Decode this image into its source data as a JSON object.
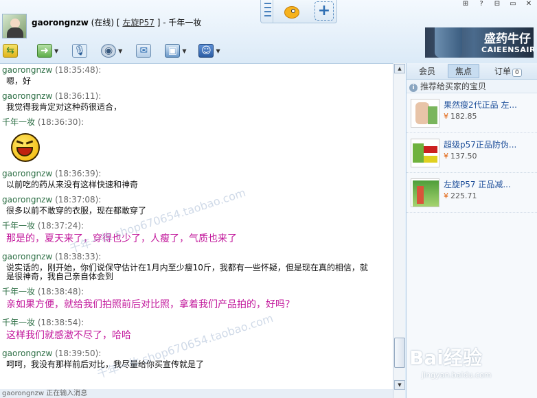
{
  "header": {
    "contact_name": "gaorongnzw",
    "status": "(在线)",
    "bracket_open": "[",
    "signature_link": "左旋P57",
    "bracket_close": "]",
    "separator": "-",
    "shop_name": "千年一妆"
  },
  "window_buttons": [
    "⊞",
    "?",
    "⊟",
    "▭",
    "✕"
  ],
  "banner": {
    "title": "盛药牛仔",
    "subtitle": "CAIEENSAIR"
  },
  "chat": {
    "messages": [
      {
        "sender": "gaorongnzw",
        "time": "(18:35:48):",
        "text": "嗯，好"
      },
      {
        "sender": "gaorongnzw",
        "time": "(18:36:11):",
        "text": "我觉得我肯定对这种药很适合，"
      },
      {
        "sender": "千年一妆",
        "time": "(18:36:30):",
        "text": ""
      },
      {
        "sender": "gaorongnzw",
        "time": "(18:36:39):",
        "text": "以前吃的药从来没有这样快速和神奇"
      },
      {
        "sender": "gaorongnzw",
        "time": "(18:37:08):",
        "text": "很多以前不敢穿的衣服，现在都敢穿了"
      },
      {
        "sender": "千年一妆",
        "time": "(18:37:24):",
        "text": "那是的，夏天来了，穿得也少了，人瘦了，气质也来了"
      },
      {
        "sender": "gaorongnzw",
        "time": "(18:38:33):",
        "text": "说实话的，刚开始，你们说保守估计在1月内至少瘦10斤，我都有一些怀疑，但是现在真的相信，就是很神奇，我自己亲自体会到"
      },
      {
        "sender": "千年一妆",
        "time": "(18:38:48):",
        "text": "亲如果方便，就给我们拍照前后对比照，拿着我们产品拍的，好吗？"
      },
      {
        "sender": "千年一妆",
        "time": "(18:38:54):",
        "text": "这样我们就感激不尽了，哈哈"
      },
      {
        "sender": "gaorongnzw",
        "time": "(18:39:50):",
        "text": "呵呵，我没有那样前后对比，我尽量给你买宣传就是了"
      }
    ],
    "watermark1": "千年一妆 shop670654.taobao.com",
    "watermark2": "千年一妆 shop670654.taobao.com"
  },
  "status_bar": "gaorongnzw 正在输入消息",
  "panel": {
    "tabs": [
      {
        "label": "会员"
      },
      {
        "label": "焦点"
      },
      {
        "label": "订单",
        "badge": "0"
      }
    ],
    "recommend_label": "推荐给买家的宝贝",
    "products": [
      {
        "name": "果然瘦2代正品 左...",
        "price": "182.85",
        "currency": "¥"
      },
      {
        "name": "超级p57正品防伪...",
        "price": "137.50",
        "currency": "¥"
      },
      {
        "name": "左旋P57 正品减...",
        "price": "225.71",
        "currency": "¥"
      }
    ]
  },
  "watermark_site": {
    "logo": "Bai经验",
    "url": "jingyan.baidu.com"
  }
}
